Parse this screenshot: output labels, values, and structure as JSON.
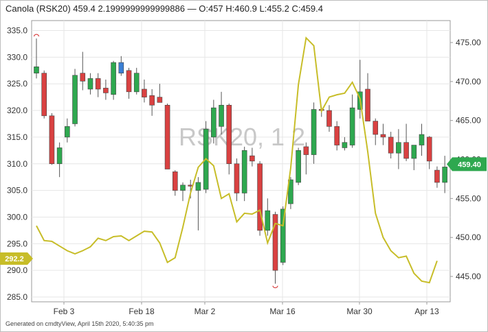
{
  "header": {
    "symbol": "Canola (RSK20)",
    "last": "459.4",
    "change": "2.1999999999999886",
    "sep": "—",
    "open": "O:457",
    "high": "H:460.9",
    "low": "L:455.2",
    "close": "C:459.4"
  },
  "footer": {
    "text": "Generated on cmdtyView, April 15th 2020, 5:40:35 pm"
  },
  "watermark": "RSK20, 1 2",
  "colors": {
    "up": "#2ea84f",
    "down": "#d94141",
    "highlight": "#3a7fd5",
    "line": "#c7bd28",
    "grid": "#e6e6e6",
    "axis": "#999999"
  },
  "chart_data": {
    "type": "candlestick",
    "x_tick_labels": [
      "Feb 3",
      "Feb 18",
      "Mar 2",
      "Mar 16",
      "Mar 30",
      "Apr 13"
    ],
    "y_left_ticks": [
      "335.0",
      "330.0",
      "325.0",
      "320.0",
      "315.0",
      "310.0",
      "305.0",
      "300.0",
      "295.0",
      "290.0",
      "285.0"
    ],
    "y_left_range": [
      285,
      335
    ],
    "y_right_ticks": [
      "475.00",
      "470.00",
      "465.00",
      "460.00",
      "455.00",
      "450.00",
      "445.00"
    ],
    "y_right_range": [
      443,
      477
    ],
    "candles": [
      {
        "x": 0,
        "o": 327.0,
        "h": 333.5,
        "l": 326.0,
        "c": 328.2
      },
      {
        "x": 1,
        "o": 327.0,
        "h": 327.5,
        "l": 318.5,
        "c": 319.0
      },
      {
        "x": 2,
        "o": 319.0,
        "h": 319.5,
        "l": 309.8,
        "c": 310.0
      },
      {
        "x": 3,
        "o": 310.0,
        "h": 314.0,
        "l": 307.5,
        "c": 313.0
      },
      {
        "x": 4,
        "o": 315.0,
        "h": 318.5,
        "l": 314.0,
        "c": 317.0
      },
      {
        "x": 5,
        "o": 317.5,
        "h": 327.8,
        "l": 317.0,
        "c": 326.6
      },
      {
        "x": 6,
        "o": 327.0,
        "h": 331.0,
        "l": 323.8,
        "c": 325.5
      },
      {
        "x": 7,
        "o": 324.0,
        "h": 327.0,
        "l": 323.0,
        "c": 326.0
      },
      {
        "x": 8,
        "o": 326.0,
        "h": 327.0,
        "l": 322.5,
        "c": 324.0
      },
      {
        "x": 9,
        "o": 324.2,
        "h": 325.8,
        "l": 322.0,
        "c": 323.3
      },
      {
        "x": 10,
        "o": 323.0,
        "h": 329.3,
        "l": 322.0,
        "c": 329.0
      },
      {
        "x": 11,
        "o": 329.0,
        "h": 330.2,
        "l": 326.5,
        "c": 327.0,
        "hl": true
      },
      {
        "x": 12,
        "o": 327.5,
        "h": 328.0,
        "l": 322.2,
        "c": 323.5
      },
      {
        "x": 13,
        "o": 323.5,
        "h": 328.0,
        "l": 323.0,
        "c": 327.0
      },
      {
        "x": 14,
        "o": 324.0,
        "h": 325.8,
        "l": 321.5,
        "c": 322.5
      },
      {
        "x": 15,
        "o": 322.8,
        "h": 324.0,
        "l": 319.0,
        "c": 321.0
      },
      {
        "x": 16,
        "o": 322.5,
        "h": 325.0,
        "l": 321.5,
        "c": 321.5
      },
      {
        "x": 17,
        "o": 321.0,
        "h": 321.3,
        "l": 309.0,
        "c": 309.0
      },
      {
        "x": 18,
        "o": 308.5,
        "h": 308.8,
        "l": 304.0,
        "c": 305.0
      },
      {
        "x": 19,
        "o": 305.0,
        "h": 306.5,
        "l": 303.0,
        "c": 306.0
      },
      {
        "x": 20,
        "o": 306.0,
        "h": 307.0,
        "l": 303.5,
        "c": 305.8
      },
      {
        "x": 21,
        "o": 305.0,
        "h": 307.5,
        "l": 297.5,
        "c": 306.5
      },
      {
        "x": 22,
        "o": 305.2,
        "h": 318.0,
        "l": 304.5,
        "c": 316.5
      },
      {
        "x": 23,
        "o": 315.0,
        "h": 322.0,
        "l": 313.8,
        "c": 320.5
      },
      {
        "x": 24,
        "o": 317.0,
        "h": 323.5,
        "l": 315.5,
        "c": 321.0
      },
      {
        "x": 25,
        "o": 321.0,
        "h": 321.3,
        "l": 308.0,
        "c": 310.0
      },
      {
        "x": 26,
        "o": 310.0,
        "h": 311.0,
        "l": 303.0,
        "c": 304.5
      },
      {
        "x": 27,
        "o": 304.5,
        "h": 313.2,
        "l": 303.0,
        "c": 312.5
      },
      {
        "x": 28,
        "o": 311.5,
        "h": 313.0,
        "l": 309.5,
        "c": 310.5
      },
      {
        "x": 29,
        "o": 310.0,
        "h": 310.5,
        "l": 296.5,
        "c": 297.5
      },
      {
        "x": 30,
        "o": 297.5,
        "h": 303.5,
        "l": 296.5,
        "c": 301.2
      },
      {
        "x": 31,
        "o": 300.5,
        "h": 301.0,
        "l": 287.5,
        "c": 290.0
      },
      {
        "x": 32,
        "o": 291.5,
        "h": 302.0,
        "l": 291.0,
        "c": 301.5
      },
      {
        "x": 33,
        "o": 302.5,
        "h": 307.5,
        "l": 301.5,
        "c": 307.0
      },
      {
        "x": 34,
        "o": 306.5,
        "h": 313.0,
        "l": 306.0,
        "c": 312.5
      },
      {
        "x": 35,
        "o": 313.2,
        "h": 314.0,
        "l": 308.0,
        "c": 311.7
      },
      {
        "x": 36,
        "o": 311.7,
        "h": 321.5,
        "l": 310.0,
        "c": 320.2
      },
      {
        "x": 37,
        "o": 320.2,
        "h": 320.6,
        "l": 318.8,
        "c": 320.0
      },
      {
        "x": 38,
        "o": 320.0,
        "h": 321.0,
        "l": 316.0,
        "c": 317.0
      },
      {
        "x": 39,
        "o": 317.0,
        "h": 318.0,
        "l": 312.5,
        "c": 313.5
      },
      {
        "x": 40,
        "o": 313.0,
        "h": 315.0,
        "l": 312.5,
        "c": 314.0
      },
      {
        "x": 41,
        "o": 313.5,
        "h": 323.0,
        "l": 313.0,
        "c": 320.5
      },
      {
        "x": 42,
        "o": 320.2,
        "h": 329.5,
        "l": 318.5,
        "c": 323.5
      },
      {
        "x": 43,
        "o": 324.0,
        "h": 327.0,
        "l": 318.0,
        "c": 318.0
      },
      {
        "x": 44,
        "o": 318.0,
        "h": 318.5,
        "l": 313.5,
        "c": 315.5
      },
      {
        "x": 45,
        "o": 315.5,
        "h": 317.5,
        "l": 313.5,
        "c": 315.0
      },
      {
        "x": 46,
        "o": 315.0,
        "h": 316.0,
        "l": 311.0,
        "c": 312.0
      },
      {
        "x": 47,
        "o": 312.0,
        "h": 316.5,
        "l": 309.0,
        "c": 314.0
      },
      {
        "x": 48,
        "o": 314.0,
        "h": 317.5,
        "l": 310.5,
        "c": 311.0
      },
      {
        "x": 49,
        "o": 311.0,
        "h": 313.0,
        "l": 308.8,
        "c": 313.5
      },
      {
        "x": 50,
        "o": 313.5,
        "h": 317.5,
        "l": 311.5,
        "c": 315.5
      },
      {
        "x": 51,
        "o": 315.0,
        "h": 315.2,
        "l": 309.0,
        "c": 310.5
      },
      {
        "x": 52,
        "o": 308.8,
        "h": 309.5,
        "l": 305.5,
        "c": 306.5
      },
      {
        "x": 53,
        "o": 306.5,
        "h": 311.5,
        "l": 304.5,
        "c": 309.4
      }
    ],
    "overlay_line": {
      "axis": "right",
      "values": [
        451.5,
        449.6,
        449.5,
        448.9,
        448.3,
        447.9,
        448.3,
        448.8,
        449.9,
        449.6,
        450.1,
        450.2,
        449.6,
        450.2,
        450.8,
        450.7,
        449.3,
        446.8,
        447.4,
        451.3,
        455.7,
        459.0,
        460.1,
        459.2,
        455.0,
        455.6,
        452.0,
        453.1,
        453.0,
        453.5,
        449.3,
        451.8,
        451.5,
        458.9,
        469.6,
        475.6,
        474.6,
        466.2,
        468.0,
        468.3,
        468.5,
        469.9,
        467.8,
        461.0,
        453.1,
        450.0,
        448.3,
        447.4,
        447.6,
        445.4,
        444.4,
        444.2,
        447.0
      ]
    },
    "markers": [
      {
        "label": "high",
        "x": 0,
        "value": 333.5
      },
      {
        "label": "low",
        "x": 31,
        "value": 287.5
      }
    ],
    "badges": {
      "left_value": "292.2",
      "left_at": 292.2,
      "right_value": "459.40",
      "right_at": 459.4
    }
  }
}
